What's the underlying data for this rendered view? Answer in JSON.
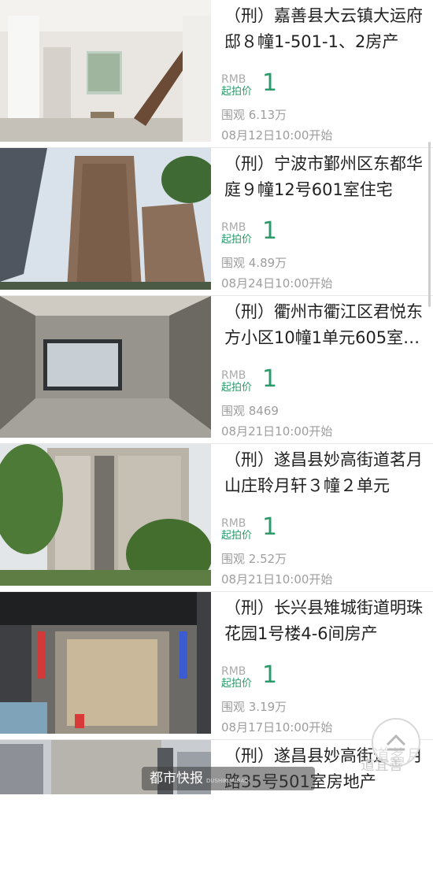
{
  "listings": [
    {
      "title": "（刑）嘉善县大云镇大运府邸８幢1-501-1、2房产",
      "currency": "RMB",
      "start_label": "起拍价",
      "price": "1",
      "views": "围观 6.13万",
      "start_time": "08月12日10:00开始"
    },
    {
      "title": "（刑）宁波市鄞州区东都华庭９幢12号601室住宅房…",
      "currency": "RMB",
      "start_label": "起拍价",
      "price": "1",
      "views": "围观 4.89万",
      "start_time": "08月24日10:00开始"
    },
    {
      "title": "（刑）衢州市衢江区君悦东方小区10幢1单元605室…",
      "currency": "RMB",
      "start_label": "起拍价",
      "price": "1",
      "views": "围观 8469",
      "start_time": "08月21日10:00开始"
    },
    {
      "title": "（刑）遂昌县妙高街道茗月山庄聆月轩３幢２单元10…",
      "currency": "RMB",
      "start_label": "起拍价",
      "price": "1",
      "views": "围观 2.52万",
      "start_time": "08月21日10:00开始"
    },
    {
      "title": "（刑）长兴县雉城街道明珠花园1号楼4-6间房产",
      "currency": "RMB",
      "start_label": "起拍价",
      "price": "1",
      "views": "围观 3.19万",
      "start_time": "08月17日10:00开始"
    },
    {
      "title": "（刑）遂昌县妙高街道茗月路35号501室房地产",
      "currency": "RMB",
      "start_label": "起拍价",
      "price": "1",
      "views": "",
      "start_time": ""
    }
  ],
  "watermark": {
    "text": "都市快报",
    "sub": "DUSHIKUAIBAO",
    "corner": "道宜善"
  },
  "icons": {
    "back_to_top": "chevron-up-icon"
  },
  "colors": {
    "accent": "#2e9a6c",
    "muted": "#9e9e9e"
  }
}
